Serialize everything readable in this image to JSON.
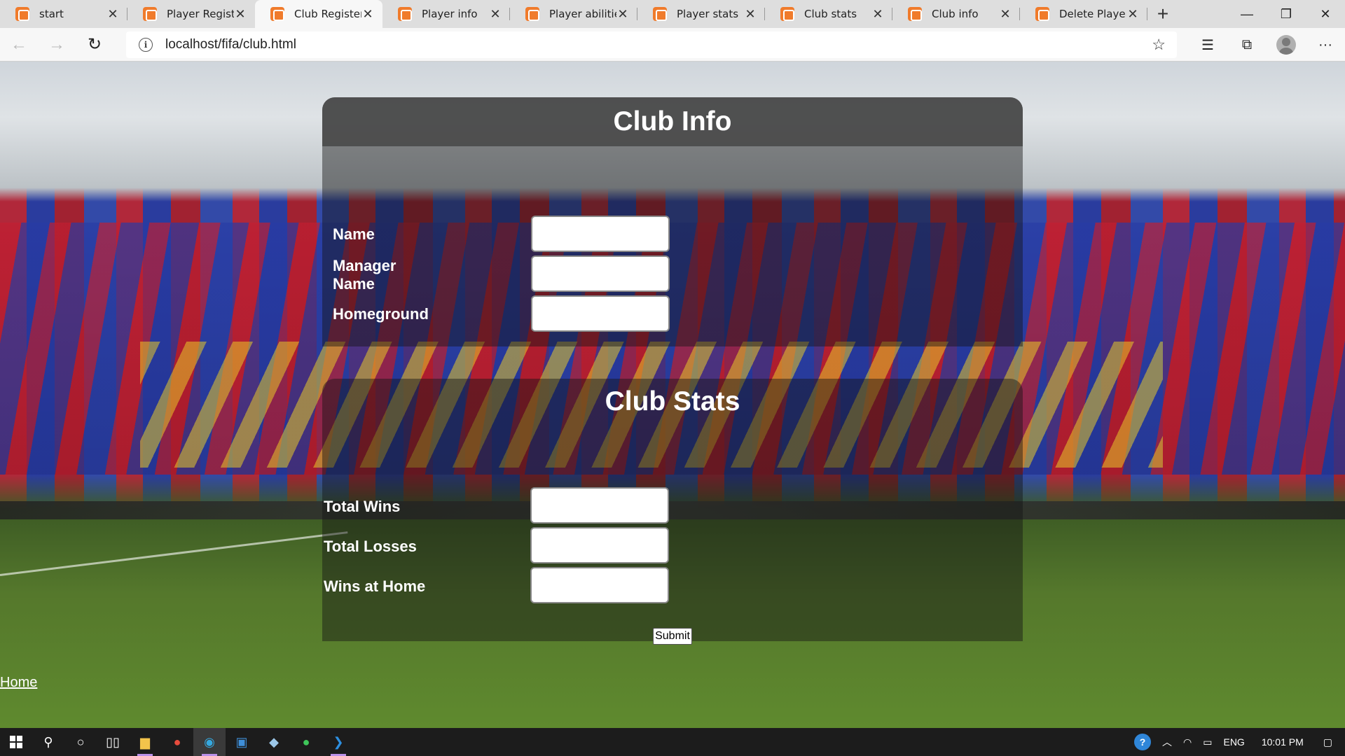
{
  "browser": {
    "tabs": [
      {
        "title": "start"
      },
      {
        "title": "Player Register"
      },
      {
        "title": "Club Register F"
      },
      {
        "title": "Player info"
      },
      {
        "title": "Player abilities"
      },
      {
        "title": "Player stats"
      },
      {
        "title": "Club stats"
      },
      {
        "title": "Club info"
      },
      {
        "title": "Delete Player"
      }
    ],
    "active_tab_index": 2,
    "url": "localhost/fifa/club.html"
  },
  "page": {
    "club_info": {
      "heading": "Club Info",
      "fields": [
        {
          "label": "Name",
          "value": ""
        },
        {
          "label": "Manager Name",
          "value": ""
        },
        {
          "label": "Homeground",
          "value": ""
        }
      ]
    },
    "club_stats": {
      "heading": "Club Stats",
      "fields": [
        {
          "label": "Total Wins",
          "value": ""
        },
        {
          "label": "Total Losses",
          "value": ""
        },
        {
          "label": "Wins at Home",
          "value": ""
        }
      ],
      "submit_label": "Submit"
    },
    "home_link": "Home"
  },
  "taskbar": {
    "language": "ENG",
    "time": "10:01 PM"
  },
  "colors": {
    "tab_favicon": "#f07b2b",
    "panel_header": "#464646",
    "taskbar": "#1c1c1c"
  }
}
